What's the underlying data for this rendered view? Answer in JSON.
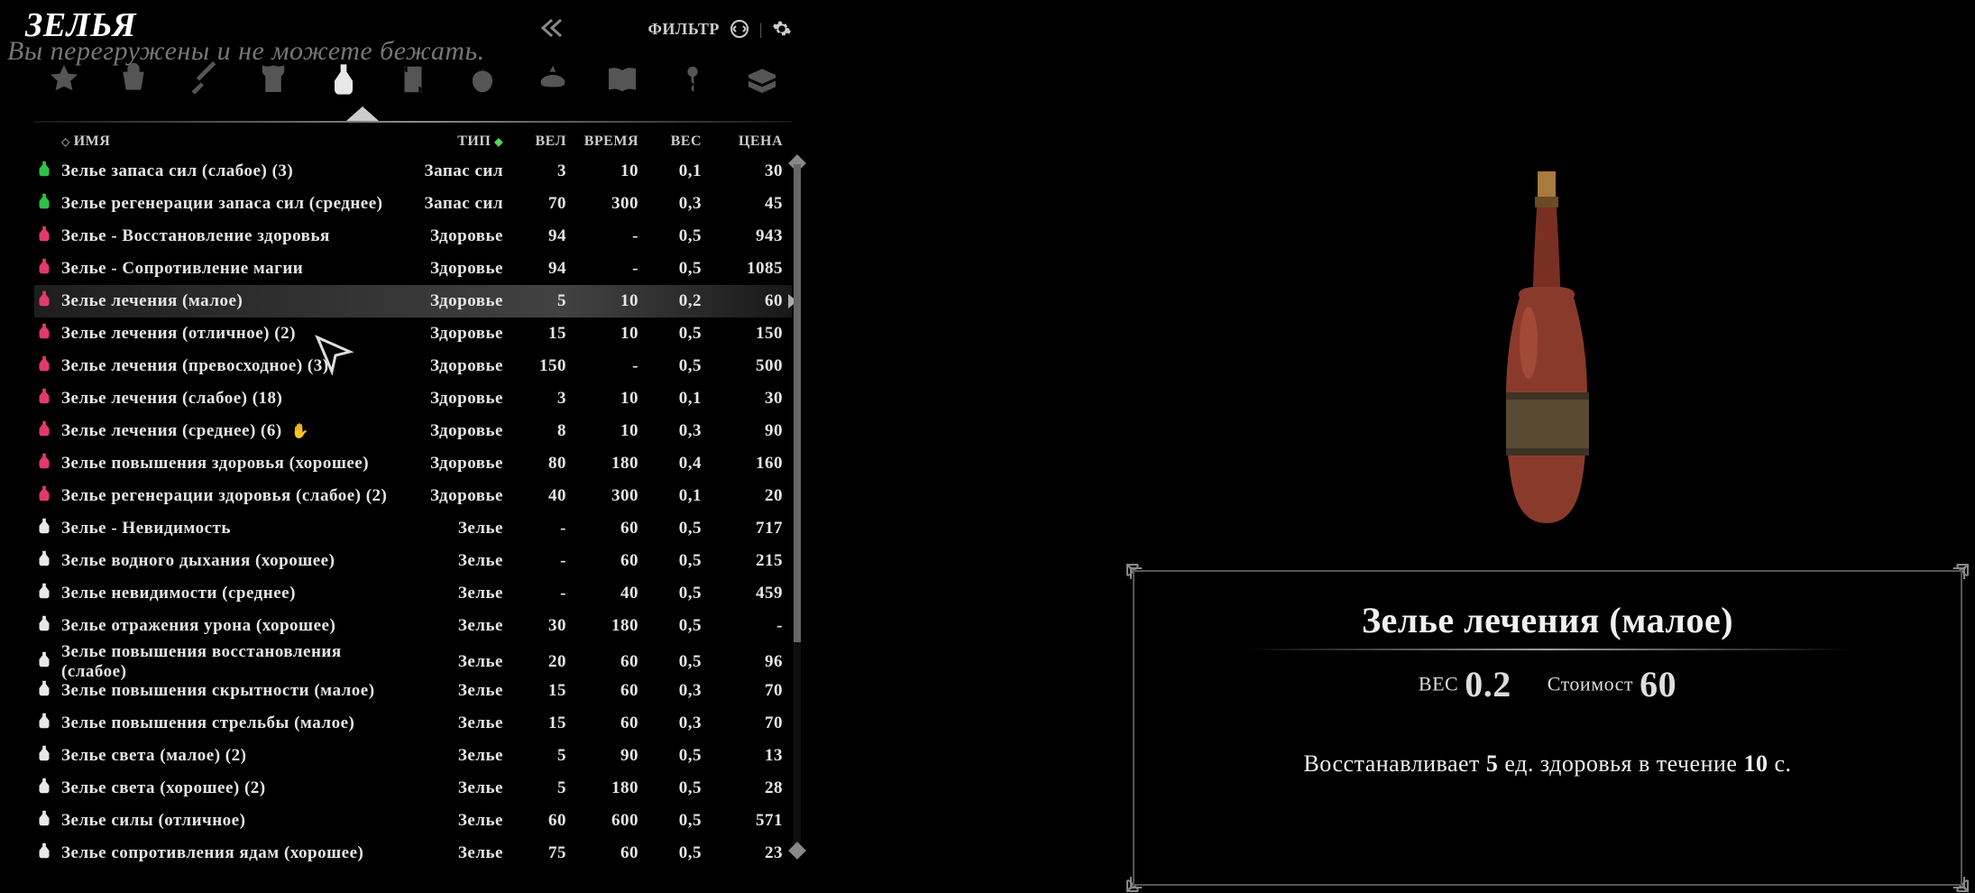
{
  "header": {
    "title": "ЗЕЛЬЯ",
    "overburdened_msg": "Вы перегружены и не можете бежать.",
    "filter_label": "ФИЛЬТР"
  },
  "columns": {
    "name": "ИМЯ",
    "type": "ТИП",
    "mag": "ВЕЛ",
    "dur": "ВРЕМЯ",
    "weight": "ВЕС",
    "value": "ЦЕНА"
  },
  "category_tabs": [
    {
      "id": "favorites",
      "active": false
    },
    {
      "id": "all",
      "active": false
    },
    {
      "id": "weapons",
      "active": false
    },
    {
      "id": "armor",
      "active": false
    },
    {
      "id": "potions",
      "active": true
    },
    {
      "id": "scrolls",
      "active": false
    },
    {
      "id": "food",
      "active": false
    },
    {
      "id": "ingredients",
      "active": false
    },
    {
      "id": "books",
      "active": false
    },
    {
      "id": "keys",
      "active": false
    },
    {
      "id": "misc",
      "active": false
    }
  ],
  "potions": [
    {
      "icon": "green",
      "name": "Зелье запаса сил (слабое) (3)",
      "type": "Запас сил",
      "mag": "3",
      "dur": "10",
      "weight": "0,1",
      "value": "30"
    },
    {
      "icon": "green",
      "name": "Зелье регенерации запаса сил (среднее)",
      "type": "Запас сил",
      "mag": "70",
      "dur": "300",
      "weight": "0,3",
      "value": "45"
    },
    {
      "icon": "red",
      "name": "Зелье - Восстановление здоровья",
      "type": "Здоровье",
      "mag": "94",
      "dur": "-",
      "weight": "0,5",
      "value": "943"
    },
    {
      "icon": "red",
      "name": "Зелье - Сопротивление магии",
      "type": "Здоровье",
      "mag": "94",
      "dur": "-",
      "weight": "0,5",
      "value": "1085"
    },
    {
      "icon": "red",
      "name": "Зелье лечения (малое)",
      "type": "Здоровье",
      "mag": "5",
      "dur": "10",
      "weight": "0,2",
      "value": "60",
      "selected": true
    },
    {
      "icon": "red",
      "name": "Зелье лечения (отличное) (2)",
      "type": "Здоровье",
      "mag": "15",
      "dur": "10",
      "weight": "0,5",
      "value": "150"
    },
    {
      "icon": "red",
      "name": "Зелье лечения (превосходное) (3)",
      "type": "Здоровье",
      "mag": "150",
      "dur": "-",
      "weight": "0,5",
      "value": "500"
    },
    {
      "icon": "red",
      "name": "Зелье лечения (слабое) (18)",
      "type": "Здоровье",
      "mag": "3",
      "dur": "10",
      "weight": "0,1",
      "value": "30"
    },
    {
      "icon": "red",
      "name": "Зелье лечения (среднее) (6)",
      "type": "Здоровье",
      "mag": "8",
      "dur": "10",
      "weight": "0,3",
      "value": "90",
      "hand": true
    },
    {
      "icon": "red",
      "name": "Зелье повышения здоровья (хорошее)",
      "type": "Здоровье",
      "mag": "80",
      "dur": "180",
      "weight": "0,4",
      "value": "160"
    },
    {
      "icon": "red",
      "name": "Зелье регенерации здоровья (слабое) (2)",
      "type": "Здоровье",
      "mag": "40",
      "dur": "300",
      "weight": "0,1",
      "value": "20"
    },
    {
      "icon": "white",
      "name": "Зелье - Невидимость",
      "type": "Зелье",
      "mag": "-",
      "dur": "60",
      "weight": "0,5",
      "value": "717"
    },
    {
      "icon": "white",
      "name": "Зелье водного дыхания (хорошее)",
      "type": "Зелье",
      "mag": "-",
      "dur": "60",
      "weight": "0,5",
      "value": "215"
    },
    {
      "icon": "white",
      "name": "Зелье невидимости (среднее)",
      "type": "Зелье",
      "mag": "-",
      "dur": "40",
      "weight": "0,5",
      "value": "459"
    },
    {
      "icon": "white",
      "name": "Зелье отражения урона (хорошее)",
      "type": "Зелье",
      "mag": "30",
      "dur": "180",
      "weight": "0,5",
      "value": "-"
    },
    {
      "icon": "white",
      "name": "Зелье повышения восстановления (слабое)",
      "type": "Зелье",
      "mag": "20",
      "dur": "60",
      "weight": "0,5",
      "value": "96"
    },
    {
      "icon": "white",
      "name": "Зелье повышения скрытности (малое)",
      "type": "Зелье",
      "mag": "15",
      "dur": "60",
      "weight": "0,3",
      "value": "70"
    },
    {
      "icon": "white",
      "name": "Зелье повышения стрельбы (малое)",
      "type": "Зелье",
      "mag": "15",
      "dur": "60",
      "weight": "0,3",
      "value": "70"
    },
    {
      "icon": "white",
      "name": "Зелье света (малое) (2)",
      "type": "Зелье",
      "mag": "5",
      "dur": "90",
      "weight": "0,5",
      "value": "13"
    },
    {
      "icon": "white",
      "name": "Зелье света (хорошее) (2)",
      "type": "Зелье",
      "mag": "5",
      "dur": "180",
      "weight": "0,5",
      "value": "28"
    },
    {
      "icon": "white",
      "name": "Зелье силы (отличное)",
      "type": "Зелье",
      "mag": "60",
      "dur": "600",
      "weight": "0,5",
      "value": "571"
    },
    {
      "icon": "white",
      "name": "Зелье сопротивления ядам (хорошее)",
      "type": "Зелье",
      "mag": "75",
      "dur": "60",
      "weight": "0,5",
      "value": "23"
    }
  ],
  "item_card": {
    "title": "Зелье лечения (малое)",
    "weight_label": "ВЕС",
    "weight_value": "0.2",
    "value_label": "Стоимост",
    "value_value": "60",
    "desc_prefix": "Восстанавливает ",
    "desc_mag": "5",
    "desc_mid": " ед. здоровья в течение ",
    "desc_dur": "10",
    "desc_suffix": " с."
  },
  "icon_colors": {
    "green": "#2ec24a",
    "red": "#e23a6a",
    "white": "#e8e8e8"
  }
}
